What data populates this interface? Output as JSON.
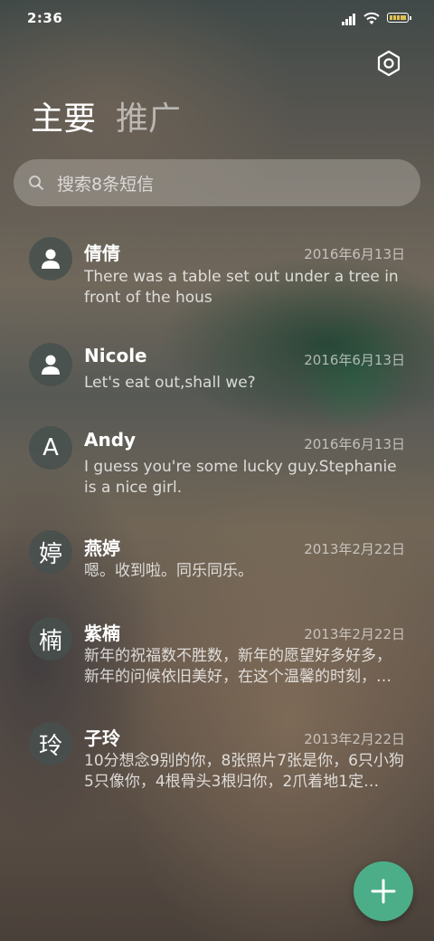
{
  "status_bar": {
    "time": "2:36"
  },
  "tabs": [
    {
      "label": "主要",
      "active": true
    },
    {
      "label": "推广",
      "active": false
    }
  ],
  "search": {
    "placeholder": "搜索8条短信"
  },
  "conversations": [
    {
      "avatar": "person-icon",
      "name": "倩倩",
      "date": "2016年6月13日",
      "message": "There was a table set out under a tree in front of the hous"
    },
    {
      "avatar": "person-icon",
      "name": "Nicole",
      "date": "2016年6月13日",
      "message": "Let's eat out,shall we?"
    },
    {
      "avatar_letter": "A",
      "name": "Andy",
      "date": "2016年6月13日",
      "message": "I guess you're some lucky guy.Stephanie is a nice girl."
    },
    {
      "avatar_letter": "婷",
      "name": "燕婷",
      "date": "2013年2月22日",
      "message": "嗯。收到啦。同乐同乐。"
    },
    {
      "avatar_letter": "楠",
      "name": "紫楠",
      "date": "2013年2月22日",
      "message": "新年的祝福数不胜数，新年的愿望好多好多，新年的问候依旧美好，在这个温馨的时刻，…"
    },
    {
      "avatar_letter": "玲",
      "name": "子玲",
      "date": "2013年2月22日",
      "message": "10分想念9别的你，8张照片7张是你，6只小狗5只像你，4根骨头3根归你，2爪着地1定…"
    }
  ],
  "colors": {
    "fab": "#4cae88",
    "battery_fill": "#e0c050"
  },
  "icons": {
    "settings": "gear-icon",
    "search": "search-icon",
    "fab": "plus-icon"
  }
}
